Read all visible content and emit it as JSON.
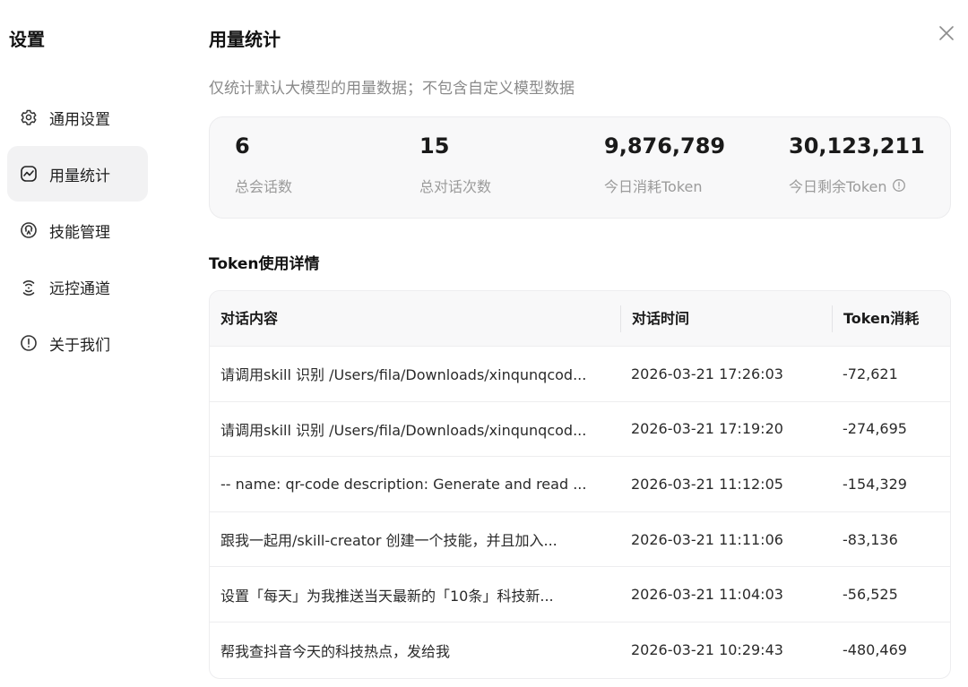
{
  "sidebar": {
    "title": "设置",
    "items": [
      {
        "label": "通用设置",
        "icon": "gear-icon",
        "active": false
      },
      {
        "label": "用量统计",
        "icon": "chart-line-icon",
        "active": true
      },
      {
        "label": "技能管理",
        "icon": "skill-icon",
        "active": false
      },
      {
        "label": "远控通道",
        "icon": "signal-icon",
        "active": false
      },
      {
        "label": "关于我们",
        "icon": "info-icon",
        "active": false
      }
    ]
  },
  "main": {
    "title": "用量统计",
    "subtitle": "仅统计默认大模型的用量数据；不包含自定义模型数据",
    "stats": [
      {
        "value": "6",
        "label": "总会话数"
      },
      {
        "value": "15",
        "label": "总对话次数"
      },
      {
        "value": "9,876,789",
        "label": "今日消耗Token"
      },
      {
        "value": "30,123,211",
        "label": "今日剩余Token"
      }
    ],
    "section_title": "Token使用详情",
    "table": {
      "headers": [
        "对话内容",
        "对话时间",
        "Token消耗"
      ],
      "rows": [
        {
          "content": "请调用skill 识别 /Users/fila/Downloads/xinqunqcod...",
          "time": "2026-03-21 17:26:03",
          "tokens": "-72,621"
        },
        {
          "content": "请调用skill 识别 /Users/fila/Downloads/xinqunqcod...",
          "time": "2026-03-21 17:19:20",
          "tokens": "-274,695"
        },
        {
          "content": "-- name: qr-code description: Generate and read ...",
          "time": "2026-03-21 11:12:05",
          "tokens": "-154,329"
        },
        {
          "content": "跟我一起用/skill-creator 创建一个技能，并且加入...",
          "time": "2026-03-21 11:11:06",
          "tokens": "-83,136"
        },
        {
          "content": "设置「每天」为我推送当天最新的「10条」科技新...",
          "time": "2026-03-21 11:04:03",
          "tokens": "-56,525"
        },
        {
          "content": "帮我查抖音今天的科技热点，发给我",
          "time": "2026-03-21 10:29:43",
          "tokens": "-480,469"
        }
      ]
    }
  },
  "colors": {
    "active_bg": "#f2f2f3",
    "card_bg": "#f8f8f9",
    "muted_text": "#8a8a8a"
  }
}
